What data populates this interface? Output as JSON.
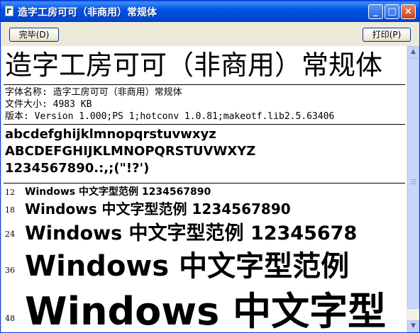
{
  "window": {
    "title": "造字工房可可（非商用）常规体"
  },
  "toolbar": {
    "done_label": "完毕(D)",
    "print_label": "打印(P)"
  },
  "font": {
    "display_name": "造字工房可可（非商用）常规体",
    "name_line": "字体名称: 造字工房可可（非商用）常规体",
    "size_line": "文件大小: 4983 KB",
    "version_line": "版本: Version 1.000;PS 1;hotconv 1.0.81;makeotf.lib2.5.63406"
  },
  "charset": {
    "lowercase": "abcdefghijklmnopqrstuvwxyz",
    "uppercase": "ABCDEFGHIJKLMNOPQRSTUVWXYZ",
    "digits": "1234567890.:,;(\"!?')"
  },
  "samples": [
    {
      "size": "12",
      "text": "Windows 中文字型范例 1234567890"
    },
    {
      "size": "18",
      "text": "Windows 中文字型范例 1234567890"
    },
    {
      "size": "24",
      "text": "Windows 中文字型范例 12345678"
    },
    {
      "size": "36",
      "text": "Windows 中文字型范例"
    },
    {
      "size": "48",
      "text": "Windows 中文字型"
    }
  ]
}
